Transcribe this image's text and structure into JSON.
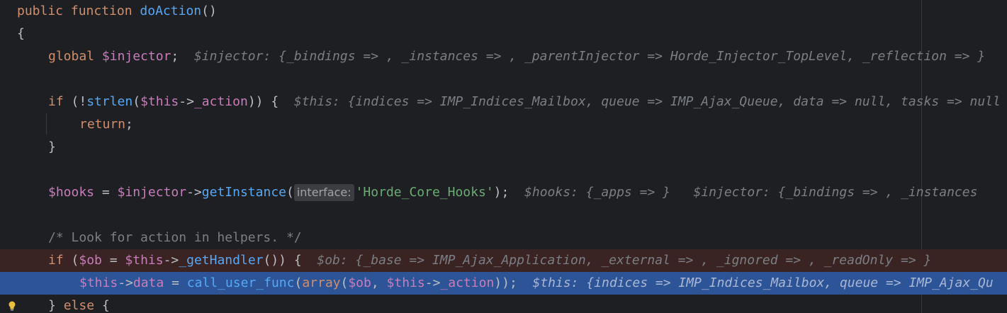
{
  "lines": {
    "l1": {
      "kw1": "public",
      "kw2": "function",
      "fn": "doAction",
      "rest": "()"
    },
    "l2": {
      "brace": "{"
    },
    "l3": {
      "kw": "global",
      "var": "$injector",
      "semi": ";",
      "inlay": "$injector: {_bindings => , _instances => , _parentInjector => Horde_Injector_TopLevel, _reflection => }"
    },
    "l5": {
      "kw": "if",
      "p1": " (!",
      "fn": "strlen",
      "p2": "(",
      "var": "$this",
      "arrow": "->",
      "prop": "_action",
      "p3": ")) {",
      "inlay": "$this: {indices => IMP_Indices_Mailbox, queue => IMP_Ajax_Queue, data => null, tasks => null"
    },
    "l6": {
      "kw": "return",
      "semi": ";"
    },
    "l7": {
      "brace": "}"
    },
    "l9": {
      "var1": "$hooks",
      "eq": " = ",
      "var2": "$injector",
      "arrow": "->",
      "fn": "getInstance",
      "p1": "(",
      "hint": "interface:",
      "str": "'Horde_Core_Hooks'",
      "p2": ");",
      "inlay1": "$hooks: {_apps => }",
      "inlay2": "$injector: {_bindings => , _instances"
    },
    "l11": {
      "comment": "/* Look for action in helpers. */"
    },
    "l12": {
      "kw": "if",
      "p1": " (",
      "var1": "$ob",
      "eq": " = ",
      "var2": "$this",
      "arrow": "->",
      "fn": "_getHandler",
      "p2": "()) {",
      "inlay": "$ob: {_base => IMP_Ajax_Application, _external => , _ignored => , _readOnly => }"
    },
    "l13": {
      "var1": "$this",
      "arrow1": "->",
      "prop1": "data",
      "eq": " = ",
      "fn": "call_user_func",
      "p1": "(",
      "kw": "array",
      "p2": "(",
      "var2": "$ob",
      "comma": ", ",
      "var3": "$this",
      "arrow2": "->",
      "prop2": "_action",
      "p3": "));",
      "inlay": "$this: {indices => IMP_Indices_Mailbox, queue => IMP_Ajax_Qu"
    },
    "l14": {
      "b1": "} ",
      "kw": "else",
      "b2": " {"
    }
  },
  "colors": {
    "background": "#1e1f22",
    "breakpoint_line": "#3a2323",
    "execution_line": "#2d5496",
    "keyword": "#cf8e6d",
    "variable": "#c77dbb",
    "function": "#56a8f5",
    "string": "#6aab73",
    "comment": "#7a7e85"
  },
  "icons": {
    "gutter": "lightbulb-icon"
  }
}
